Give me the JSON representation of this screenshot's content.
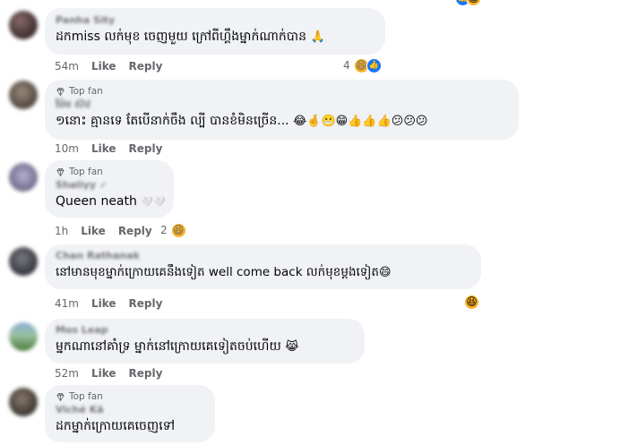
{
  "colors": {
    "bubble_bg": "#f0f2f5",
    "meta_text": "#65676b",
    "like_blue": "#1877f2",
    "haha_yellow": "#f7b125"
  },
  "comments": [
    {
      "badge": "",
      "author": "Panha Sity",
      "text": "ដកmiss លក់មុខ ចេញមួយ ក្រៅពីហ្គឹងម្នាក់ណាក់បាន",
      "emoji": "🙏",
      "time": "54m",
      "like_label": "Like",
      "reply_label": "Reply",
      "reaction_count": "4",
      "reaction_icons": [
        "haha-icon",
        "like-icon"
      ]
    },
    {
      "badge": "Top fan",
      "author": "ម៉ែម ស៊ាវ",
      "text": "១នោះ គ្មានទេ តែបើនាក់ចឹង ល្បី បានខំមិនច្រើន...",
      "emoji": "😂🤞😬😁👍👍👍😕😕😕",
      "time": "10m",
      "like_label": "Like",
      "reply_label": "Reply"
    },
    {
      "badge": "Top fan",
      "author": "Shaliyy ✓",
      "text": "Queen neath",
      "emoji": "🤍🤍",
      "time": "1h",
      "like_label": "Like",
      "reply_label": "Reply",
      "reaction_count": "2",
      "reaction_icons": [
        "haha-icon"
      ]
    },
    {
      "badge": "",
      "author": "Chan Rathanak",
      "text": "នៅមានមុខម្នាក់ក្រោយគេនឹងទៀត well come back លក់មុខម្ដងទៀត",
      "emoji": "😄",
      "time": "41m",
      "like_label": "Like",
      "reply_label": "Reply",
      "floating_reaction": "haha-icon"
    },
    {
      "badge": "",
      "author": "Mos Leap",
      "text": "ម្នកណានៅគាំទ្រ ម្នាក់នៅក្រោយគេទៀតចប់ហើយ",
      "emoji": "😹",
      "time": "52m",
      "like_label": "Like",
      "reply_label": "Reply"
    },
    {
      "badge": "Top fan",
      "author": "Viché Kā",
      "text": "ដកម្នាក់ក្រោយគេចេញទៅ",
      "emoji": "",
      "time": "",
      "like_label": "",
      "reply_label": ""
    }
  ]
}
